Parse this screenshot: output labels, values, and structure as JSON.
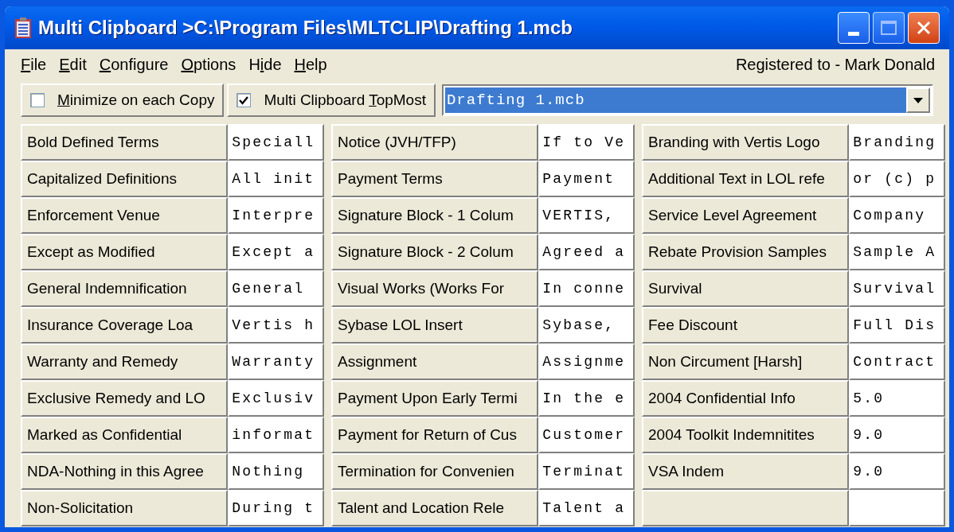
{
  "window": {
    "title": "Multi Clipboard >C:\\Program Files\\MLTCLIP\\Drafting 1.mcb"
  },
  "menu": [
    {
      "key": "F",
      "after": "ile"
    },
    {
      "key": "E",
      "after": "dit"
    },
    {
      "key": "C",
      "after": "onfigure"
    },
    {
      "key": "O",
      "after": "ptions"
    },
    {
      "before": "H",
      "key": "i",
      "after": "de"
    },
    {
      "key": "H",
      "after": "elp"
    }
  ],
  "registration": "Registered to - Mark Donald",
  "toolbar": {
    "options": [
      {
        "key": "M",
        "after": "inimize on each Copy",
        "checked": false
      },
      {
        "before": "Multi Clipboard ",
        "key": "T",
        "after": "opMost",
        "checked": true
      }
    ],
    "file_combo": {
      "value": "Drafting 1.mcb",
      "text_selected": true
    }
  },
  "columns": [
    {
      "entries": [
        {
          "label": "Bold Defined Terms",
          "value": "Speciall"
        },
        {
          "label": "Capitalized Definitions",
          "value": "All init"
        },
        {
          "label": "Enforcement Venue",
          "value": "Interpre"
        },
        {
          "label": "Except as Modified",
          "value": "Except a"
        },
        {
          "label": "General Indemnification",
          "value": "General"
        },
        {
          "label": "Insurance Coverage Loa",
          "value": "Vertis h"
        },
        {
          "label": "Warranty and Remedy",
          "value": "Warranty"
        },
        {
          "label": "Exclusive Remedy and LO",
          "value": "Exclusiv"
        },
        {
          "label": "Marked as Confidential",
          "value": "informat"
        },
        {
          "label": "NDA-Nothing in this Agree",
          "value": "Nothing"
        },
        {
          "label": "Non-Solicitation",
          "value": "During t"
        }
      ]
    },
    {
      "entries": [
        {
          "label": "Notice (JVH/TFP)",
          "value": "If to Ve"
        },
        {
          "label": "Payment Terms",
          "value": "Payment"
        },
        {
          "label": "Signature Block - 1 Colum",
          "value": "VERTIS,"
        },
        {
          "label": "Signature Block - 2 Colum",
          "value": "Agreed a"
        },
        {
          "label": "Visual Works (Works For",
          "value": "In conne"
        },
        {
          "label": "Sybase LOL Insert",
          "value": "Sybase,"
        },
        {
          "label": "Assignment",
          "value": "Assignme"
        },
        {
          "label": "Payment Upon Early Termi",
          "value": "In the e"
        },
        {
          "label": "Payment for Return of Cus",
          "value": "Customer"
        },
        {
          "label": "Termination for Convenien",
          "value": "Terminat"
        },
        {
          "label": "Talent and Location Rele",
          "value": "Talent a"
        }
      ]
    },
    {
      "entries": [
        {
          "label": "Branding with Vertis Logo",
          "value": "Branding"
        },
        {
          "label": "Additional Text in LOL refe",
          "value": "or (c) p"
        },
        {
          "label": "Service Level Agreement",
          "value": "Company"
        },
        {
          "label": "Rebate Provision Samples",
          "value": "Sample A"
        },
        {
          "label": "Survival",
          "value": "Survival"
        },
        {
          "label": "Fee Discount",
          "value": "Full Dis"
        },
        {
          "label": "Non Circument [Harsh]",
          "value": "Contract"
        },
        {
          "label": "2004 Confidential Info",
          "value": "5.0"
        },
        {
          "label": "2004 Toolkit Indemnitites",
          "value": "9.0"
        },
        {
          "label": "VSA Indem",
          "value": "9.0"
        }
      ]
    }
  ]
}
